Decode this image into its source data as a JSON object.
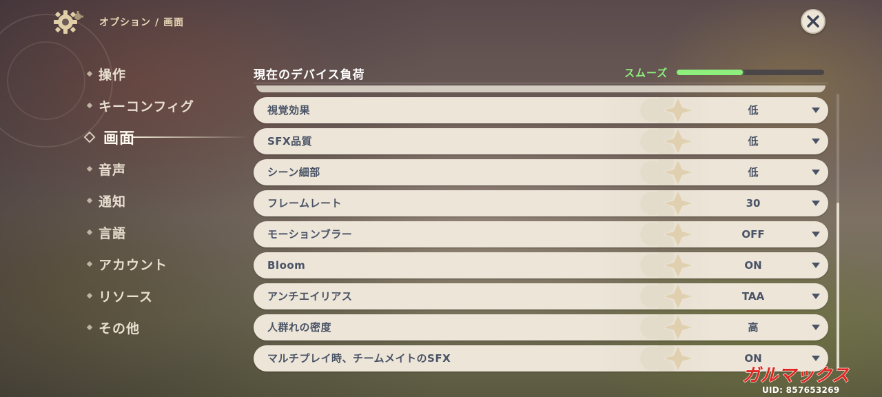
{
  "header": {
    "breadcrumb_section": "オプション",
    "breadcrumb_separator": "/",
    "breadcrumb_page": "画面",
    "settings_icon": "gear-icon",
    "close_icon": "close-icon"
  },
  "sidebar": {
    "items": [
      {
        "label": "操作",
        "active": false
      },
      {
        "label": "キーコンフィグ",
        "active": false
      },
      {
        "label": "画面",
        "active": true
      },
      {
        "label": "音声",
        "active": false
      },
      {
        "label": "通知",
        "active": false
      },
      {
        "label": "言語",
        "active": false
      },
      {
        "label": "アカウント",
        "active": false
      },
      {
        "label": "リソース",
        "active": false
      },
      {
        "label": "その他",
        "active": false
      }
    ]
  },
  "device_load": {
    "title": "現在のデバイス負荷",
    "status": "スムーズ",
    "level": 0.45,
    "status_color": "#8ef07c"
  },
  "settings": [
    {
      "label": "視覚効果",
      "value": "低"
    },
    {
      "label": "SFX品質",
      "value": "低"
    },
    {
      "label": "シーン細部",
      "value": "低"
    },
    {
      "label": "フレームレート",
      "value": "30"
    },
    {
      "label": "モーションブラー",
      "value": "OFF"
    },
    {
      "label": "Bloom",
      "value": "ON"
    },
    {
      "label": "アンチエイリアス",
      "value": "TAA"
    },
    {
      "label": "人群れの密度",
      "value": "高"
    },
    {
      "label": "マルチプレイ時、チームメイトのSFX",
      "value": "ON"
    }
  ],
  "watermark": {
    "logo_text": "ガルマックス",
    "uid": "UID: 857653269",
    "logo_color": "#e0261f"
  },
  "colors": {
    "row_background": "#ece5d8",
    "row_text": "#4a5366",
    "menu_text": "#e9dfd0",
    "header_text": "#ead9b7"
  }
}
